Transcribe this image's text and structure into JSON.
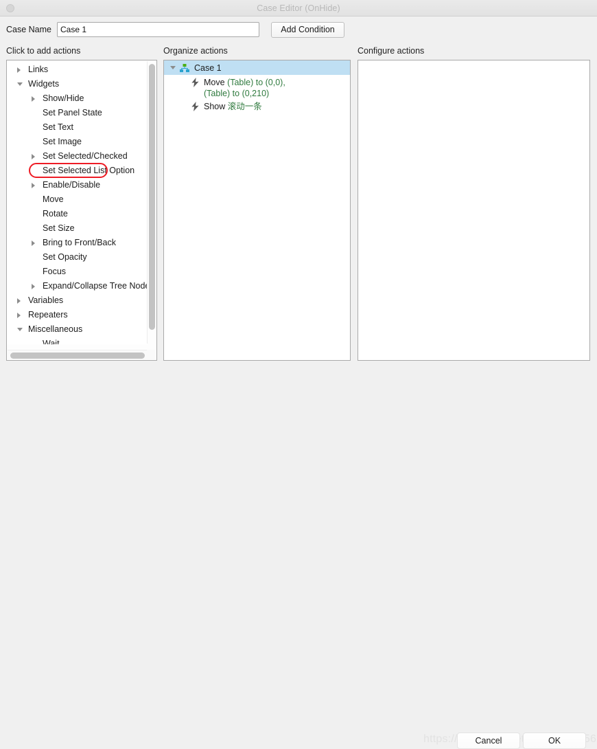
{
  "window": {
    "title": "Case Editor (OnHide)",
    "close_button": "close-button"
  },
  "case_name": {
    "label": "Case Name",
    "value": "Case 1",
    "placeholder": "Case Name",
    "add_condition_label": "Add Condition"
  },
  "columns": {
    "left_heading": "Click to add actions",
    "mid_heading": "Organize actions",
    "right_heading": "Configure actions"
  },
  "action_tree": {
    "nodes": [
      {
        "label": "Links",
        "level": 0,
        "state": "collapsed"
      },
      {
        "label": "Widgets",
        "level": 0,
        "state": "expanded"
      },
      {
        "label": "Show/Hide",
        "level": 1,
        "state": "collapsed"
      },
      {
        "label": "Set Panel State",
        "level": 1,
        "state": "leaf",
        "highlighted": true
      },
      {
        "label": "Set Text",
        "level": 1,
        "state": "leaf"
      },
      {
        "label": "Set Image",
        "level": 1,
        "state": "leaf"
      },
      {
        "label": "Set Selected/Checked",
        "level": 1,
        "state": "collapsed"
      },
      {
        "label": "Set Selected List Option",
        "level": 1,
        "state": "leaf"
      },
      {
        "label": "Enable/Disable",
        "level": 1,
        "state": "collapsed"
      },
      {
        "label": "Move",
        "level": 1,
        "state": "leaf"
      },
      {
        "label": "Rotate",
        "level": 1,
        "state": "leaf"
      },
      {
        "label": "Set Size",
        "level": 1,
        "state": "leaf"
      },
      {
        "label": "Bring to Front/Back",
        "level": 1,
        "state": "collapsed"
      },
      {
        "label": "Set Opacity",
        "level": 1,
        "state": "leaf"
      },
      {
        "label": "Focus",
        "level": 1,
        "state": "leaf"
      },
      {
        "label": "Expand/Collapse Tree Node",
        "level": 1,
        "state": "collapsed"
      },
      {
        "label": "Variables",
        "level": 0,
        "state": "collapsed"
      },
      {
        "label": "Repeaters",
        "level": 0,
        "state": "collapsed"
      },
      {
        "label": "Miscellaneous",
        "level": 0,
        "state": "expanded"
      },
      {
        "label": "Wait",
        "level": 1,
        "state": "leaf"
      }
    ]
  },
  "organize": {
    "case_label": "Case 1",
    "case_state": "expanded",
    "actions": [
      {
        "verb": "Move",
        "target_line1": "(Table) to (0,0),",
        "target_line2": "(Table) to (0,210)"
      },
      {
        "verb": "Show",
        "target_line1": "滚动一条",
        "target_line2": ""
      }
    ]
  },
  "configure": {
    "content": ""
  },
  "footer": {
    "watermark": "https://blog.csdn.net/qq_36175056",
    "cancel_label": "Cancel",
    "ok_label": "OK"
  },
  "colors": {
    "selection": "#bfdff3",
    "highlight_ring": "#ee1c25",
    "action_object_text": "#2f7a3e",
    "title_text": "#b8b8b8"
  }
}
